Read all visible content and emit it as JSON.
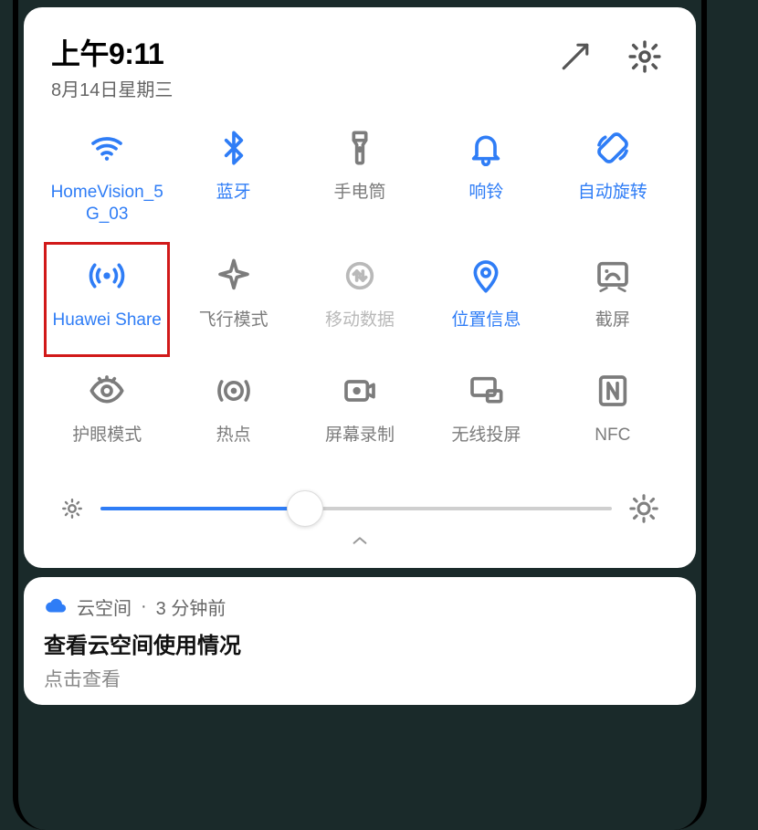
{
  "header": {
    "time": "上午9:11",
    "date": "8月14日星期三"
  },
  "tiles": [
    {
      "label": "HomeVision_5G_03",
      "state": "active",
      "icon": "wifi",
      "highlighted": false
    },
    {
      "label": "蓝牙",
      "state": "active",
      "icon": "bluetooth",
      "highlighted": false
    },
    {
      "label": "手电筒",
      "state": "inactive",
      "icon": "flashlight",
      "highlighted": false
    },
    {
      "label": "响铃",
      "state": "active",
      "icon": "bell",
      "highlighted": false
    },
    {
      "label": "自动旋转",
      "state": "active",
      "icon": "rotate",
      "highlighted": false
    },
    {
      "label": "Huawei Share",
      "state": "active",
      "icon": "share-radio",
      "highlighted": true
    },
    {
      "label": "飞行模式",
      "state": "inactive",
      "icon": "airplane",
      "highlighted": false
    },
    {
      "label": "移动数据",
      "state": "disabled",
      "icon": "mobiledata",
      "highlighted": false
    },
    {
      "label": "位置信息",
      "state": "active",
      "icon": "location",
      "highlighted": false
    },
    {
      "label": "截屏",
      "state": "inactive",
      "icon": "screenshot",
      "highlighted": false
    },
    {
      "label": "护眼模式",
      "state": "inactive",
      "icon": "eye",
      "highlighted": false
    },
    {
      "label": "热点",
      "state": "inactive",
      "icon": "hotspot",
      "highlighted": false
    },
    {
      "label": "屏幕录制",
      "state": "inactive",
      "icon": "record",
      "highlighted": false
    },
    {
      "label": "无线投屏",
      "state": "inactive",
      "icon": "cast",
      "highlighted": false
    },
    {
      "label": "NFC",
      "state": "inactive",
      "icon": "nfc",
      "highlighted": false
    }
  ],
  "brightness": {
    "percent": 40
  },
  "notification": {
    "app": "云空间",
    "separator": "·",
    "age": "3 分钟前",
    "title": "查看云空间使用情况",
    "subtitle": "点击查看"
  }
}
